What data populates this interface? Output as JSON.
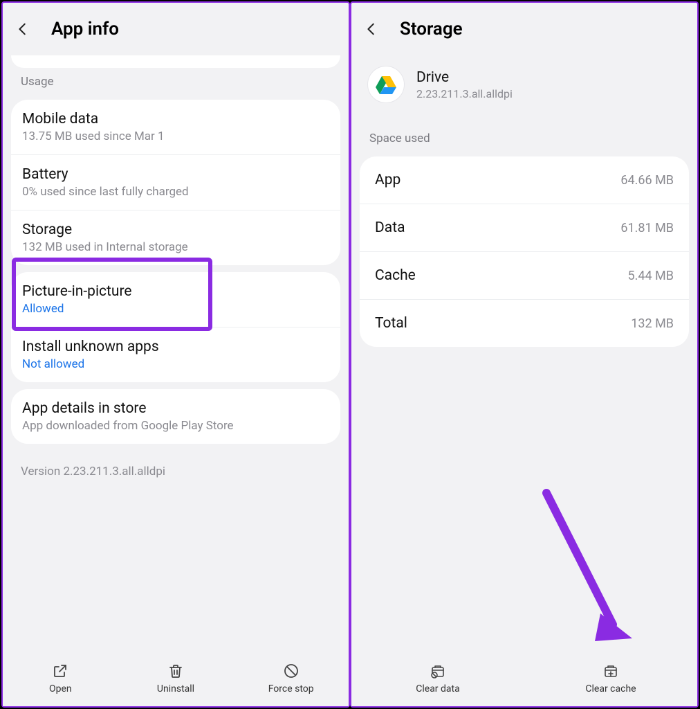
{
  "left": {
    "title": "App info",
    "usage_label": "Usage",
    "items": {
      "mobile_data": {
        "title": "Mobile data",
        "sub": "13.75 MB used since Mar 1"
      },
      "battery": {
        "title": "Battery",
        "sub": "0% used since last fully charged"
      },
      "storage": {
        "title": "Storage",
        "sub": "132 MB used in Internal storage"
      }
    },
    "pip": {
      "title": "Picture-in-picture",
      "sub": "Allowed"
    },
    "unknown": {
      "title": "Install unknown apps",
      "sub": "Not allowed"
    },
    "details": {
      "title": "App details in store",
      "sub": "App downloaded from Google Play Store"
    },
    "version_text": "Version 2.23.211.3.all.alldpi",
    "bottom": {
      "open": "Open",
      "uninstall": "Uninstall",
      "force_stop": "Force stop"
    }
  },
  "right": {
    "title": "Storage",
    "app": {
      "name": "Drive",
      "version": "2.23.211.3.all.alldpi"
    },
    "space_used_label": "Space used",
    "rows": {
      "app": {
        "key": "App",
        "val": "64.66 MB"
      },
      "data": {
        "key": "Data",
        "val": "61.81 MB"
      },
      "cache": {
        "key": "Cache",
        "val": "5.44 MB"
      },
      "total": {
        "key": "Total",
        "val": "132 MB"
      }
    },
    "bottom": {
      "clear_data": "Clear data",
      "clear_cache": "Clear cache"
    }
  },
  "annotations": {
    "highlight_color": "#8a2be2",
    "arrow_color": "#8a2be2"
  }
}
